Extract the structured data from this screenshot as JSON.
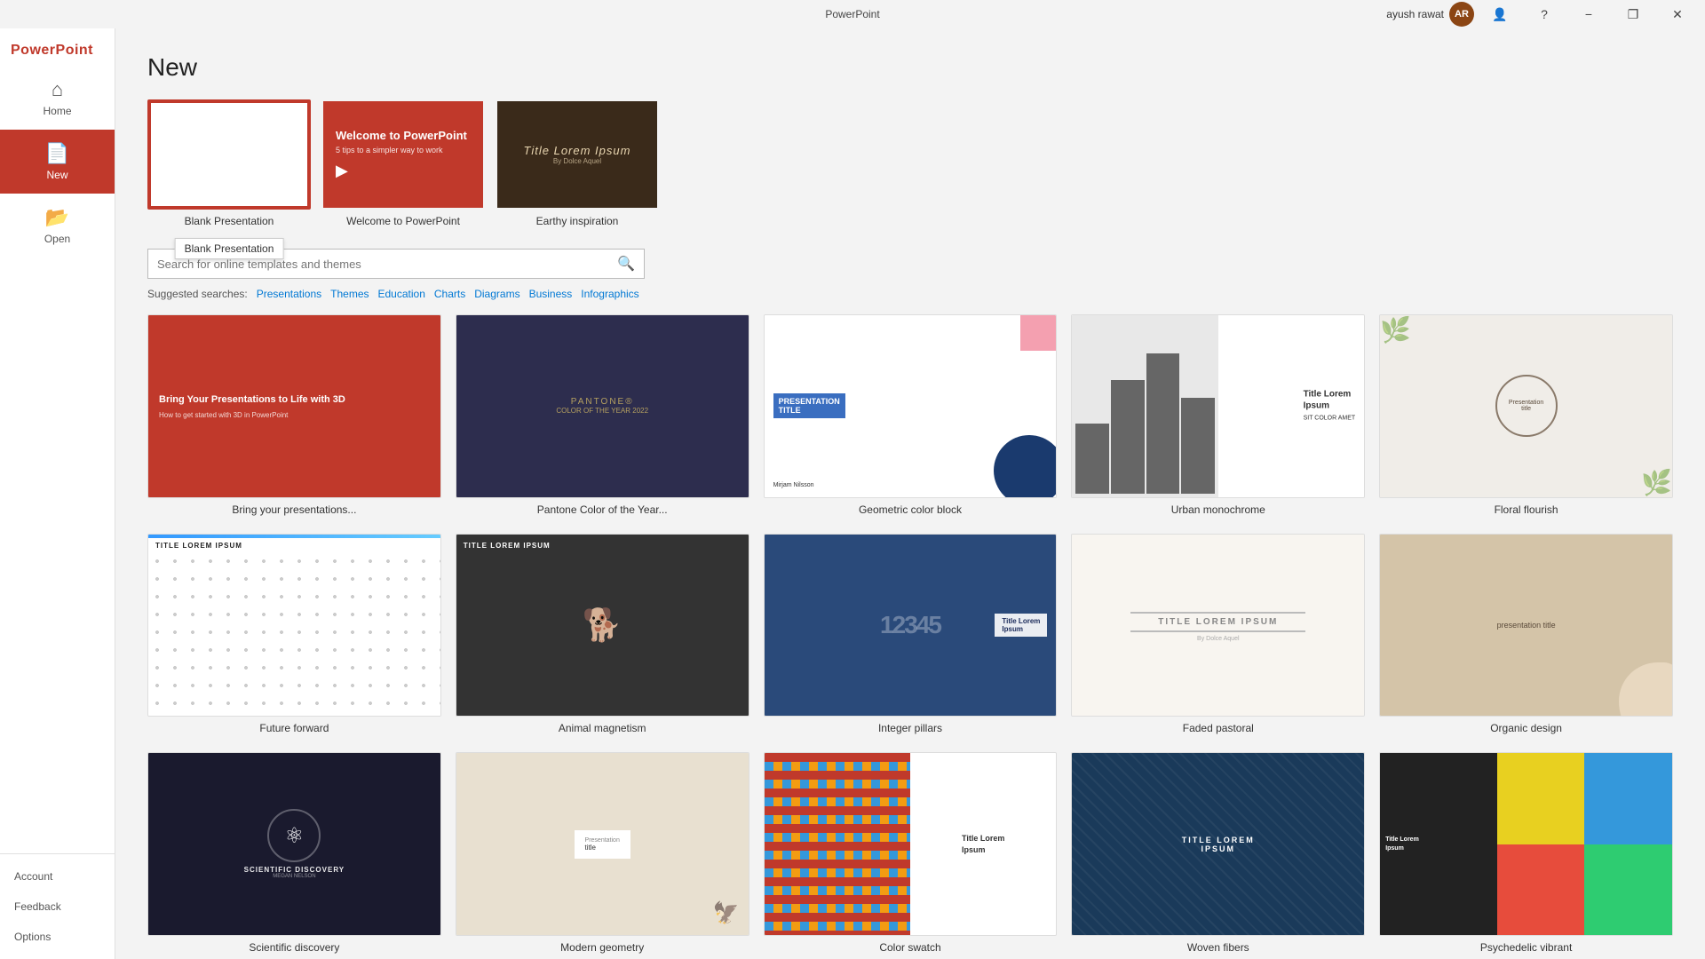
{
  "titlebar": {
    "app_name": "PowerPoint",
    "user_name": "ayush rawat",
    "minimize": "−",
    "restore": "❐",
    "close": "✕",
    "help": "?"
  },
  "sidebar": {
    "brand": "PowerPoint",
    "items": [
      {
        "id": "home",
        "label": "Home",
        "icon": "⌂",
        "active": false
      },
      {
        "id": "new",
        "label": "New",
        "icon": "📄",
        "active": true
      },
      {
        "id": "open",
        "label": "Open",
        "icon": "📂",
        "active": false
      }
    ],
    "bottom": [
      {
        "id": "account",
        "label": "Account"
      },
      {
        "id": "feedback",
        "label": "Feedback"
      },
      {
        "id": "options",
        "label": "Options"
      }
    ]
  },
  "page": {
    "title": "New"
  },
  "featured": [
    {
      "id": "blank",
      "label": "Blank Presentation",
      "tooltip": "Blank Presentation",
      "type": "blank",
      "selected": true
    },
    {
      "id": "welcome",
      "label": "Welcome to PowerPoint",
      "type": "welcome"
    },
    {
      "id": "earthy",
      "label": "Earthy inspiration",
      "type": "earthy"
    }
  ],
  "search": {
    "placeholder": "Search for online templates and themes",
    "label": "Suggested searches:",
    "suggestions": [
      "Presentations",
      "Themes",
      "Education",
      "Charts",
      "Diagrams",
      "Business",
      "Infographics"
    ]
  },
  "templates": [
    {
      "id": "bring",
      "label": "Bring your presentations...",
      "type": "bypt"
    },
    {
      "id": "pantone",
      "label": "Pantone Color of the Year...",
      "type": "pantone"
    },
    {
      "id": "geometric",
      "label": "Geometric color block",
      "type": "geometric"
    },
    {
      "id": "urban",
      "label": "Urban monochrome",
      "type": "urban"
    },
    {
      "id": "floral",
      "label": "Floral flourish",
      "type": "floral"
    },
    {
      "id": "future",
      "label": "Future forward",
      "type": "future"
    },
    {
      "id": "animal",
      "label": "Animal magnetism",
      "type": "animal"
    },
    {
      "id": "integer",
      "label": "Integer pillars",
      "type": "integer"
    },
    {
      "id": "faded",
      "label": "Faded pastoral",
      "type": "faded"
    },
    {
      "id": "organic",
      "label": "Organic design",
      "type": "organic"
    },
    {
      "id": "scientific",
      "label": "Scientific discovery",
      "type": "scientific"
    },
    {
      "id": "modern",
      "label": "Modern geometry",
      "type": "modern"
    },
    {
      "id": "swatch",
      "label": "Color swatch",
      "type": "swatch"
    },
    {
      "id": "woven",
      "label": "Woven fibers",
      "type": "woven"
    },
    {
      "id": "psyche",
      "label": "Psychedelic vibrant",
      "type": "psyche"
    }
  ]
}
